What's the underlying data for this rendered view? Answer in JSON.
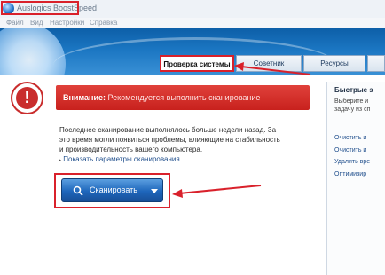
{
  "window": {
    "title": "Auslogics BoostSpeed"
  },
  "menu": {
    "items": [
      {
        "label": "Файл"
      },
      {
        "label": "Вид"
      },
      {
        "label": "Настройки"
      },
      {
        "label": "Справка"
      }
    ]
  },
  "tabs": [
    {
      "label": "Проверка системы",
      "active": true
    },
    {
      "label": "Советник",
      "active": false
    },
    {
      "label": "Ресурсы",
      "active": false
    },
    {
      "label": "",
      "active": false
    }
  ],
  "warning": {
    "prefix": "Внимание:",
    "message": "Рекомендуется выполнить сканирование",
    "icon": "!"
  },
  "description": "Последнее сканирование выполнялось больше недели назад. За это время могли появиться проблемы, влияющие на стабильность и производительность вашего компьютера.",
  "scan_params_link": "Показать параметры сканирования",
  "scan_button": {
    "label": "Сканировать"
  },
  "sidebar": {
    "title": "Быстрые з",
    "subtitle_lines": [
      "Выберите и",
      "задачу из сп"
    ],
    "links": [
      "Очистить и",
      "Очистить и",
      "Удалить вре",
      "Оптимизир"
    ]
  },
  "colors": {
    "highlight": "#d9212b",
    "warning": "#c8211d",
    "accent": "#1e66bb"
  }
}
